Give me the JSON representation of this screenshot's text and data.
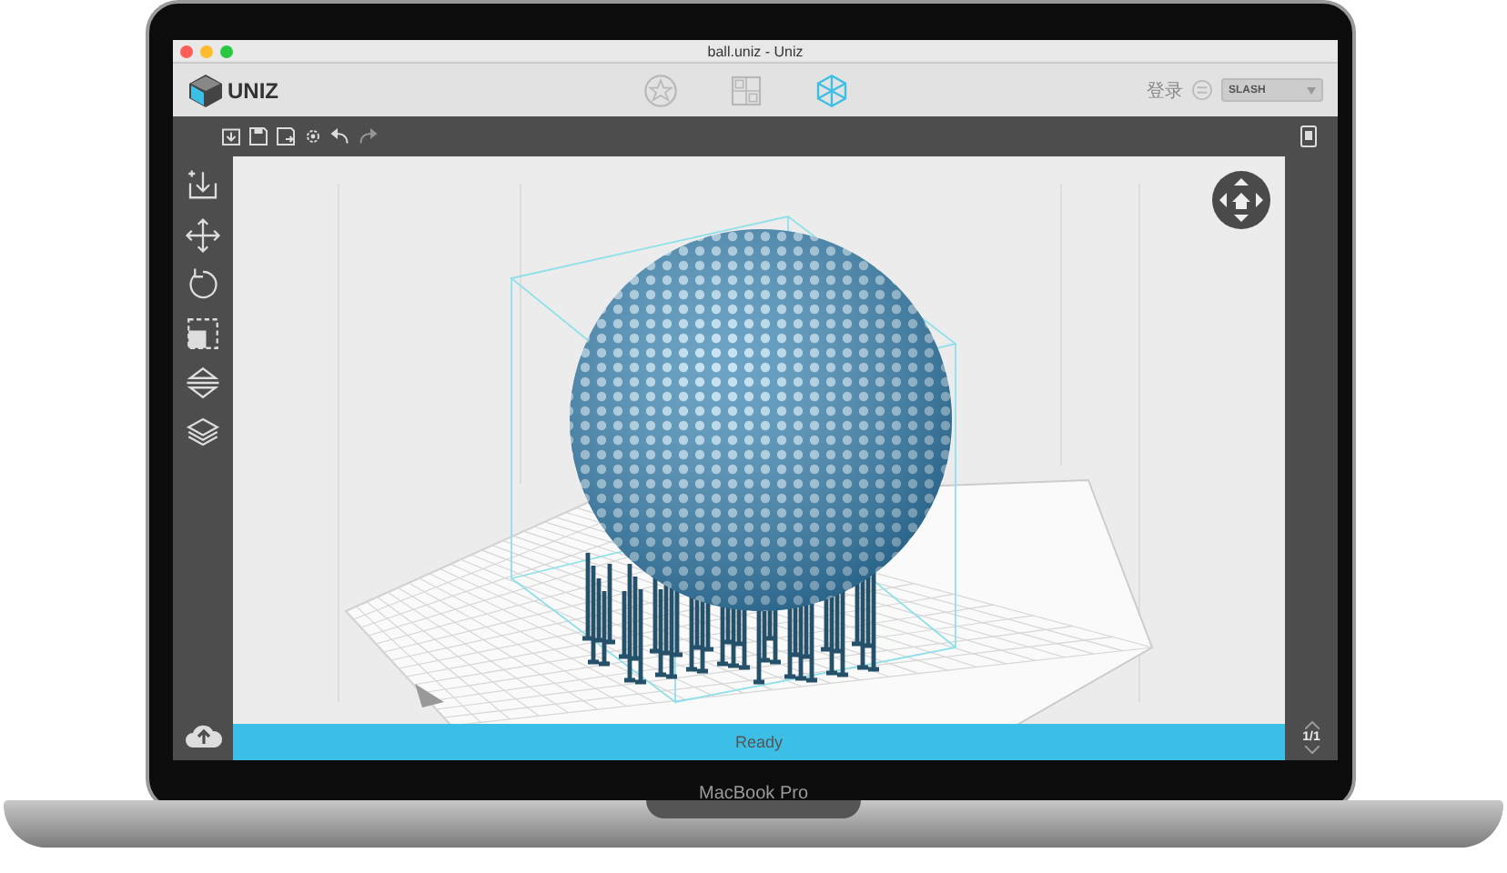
{
  "window": {
    "title": "ball.uniz - Uniz"
  },
  "header": {
    "logo": "UNIZ",
    "tabs": [
      {
        "kind": "star",
        "selected": false
      },
      {
        "kind": "grid",
        "selected": false
      },
      {
        "kind": "cube",
        "selected": true
      }
    ],
    "login": "登录",
    "printer": "SLASH"
  },
  "toolbar": {
    "tools": [
      {
        "kind": "import"
      },
      {
        "kind": "save"
      },
      {
        "kind": "save-as"
      },
      {
        "kind": "settings"
      },
      {
        "kind": "undo",
        "disabled": false
      },
      {
        "kind": "redo",
        "disabled": true
      }
    ]
  },
  "sidebar": {
    "tools": [
      {
        "kind": "import"
      },
      {
        "kind": "move"
      },
      {
        "kind": "rotate"
      },
      {
        "kind": "scale"
      },
      {
        "kind": "mirror"
      },
      {
        "kind": "layers"
      }
    ]
  },
  "status_bar": {
    "text": "Ready"
  },
  "pager": {
    "text": "1/1"
  },
  "device_label": "MacBook Pro"
}
